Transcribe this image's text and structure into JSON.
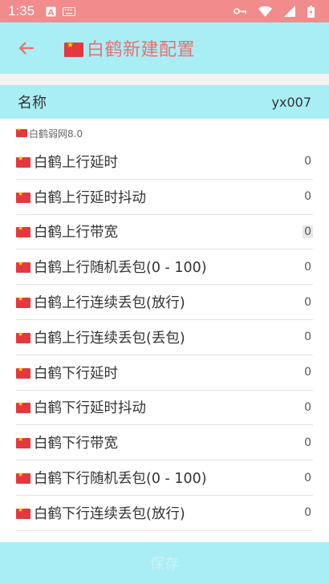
{
  "status_bar": {
    "time": "1:35"
  },
  "appbar": {
    "title": "白鹤新建配置"
  },
  "name_field": {
    "label": "名称",
    "value": "yx007"
  },
  "section": {
    "label": "白鹤弱网8.0"
  },
  "rows": [
    {
      "label": "白鹤上行延时",
      "value": "0"
    },
    {
      "label": "白鹤上行延时抖动",
      "value": "0"
    },
    {
      "label": "白鹤上行带宽",
      "value": "0"
    },
    {
      "label": "白鹤上行随机丢包(0 - 100)",
      "value": "0"
    },
    {
      "label": "白鹤上行连续丢包(放行)",
      "value": "0"
    },
    {
      "label": "白鹤上行连续丢包(丢包)",
      "value": "0"
    },
    {
      "label": "白鹤下行延时",
      "value": "0"
    },
    {
      "label": "白鹤下行延时抖动",
      "value": "0"
    },
    {
      "label": "白鹤下行带宽",
      "value": "0"
    },
    {
      "label": "白鹤下行随机丢包(0 - 100)",
      "value": "0"
    },
    {
      "label": "白鹤下行连续丢包(放行)",
      "value": "0"
    }
  ],
  "save_button": {
    "label": "保存"
  },
  "colors": {
    "accent": "#a9eef5",
    "status_bar": "#f28b8b",
    "title": "#e86f6f"
  },
  "icons": [
    "app-a-icon",
    "keyboard-icon",
    "vpn-key-icon",
    "wifi-icon",
    "signal-icon",
    "battery-icon",
    "back-arrow-icon",
    "china-flag-icon"
  ]
}
